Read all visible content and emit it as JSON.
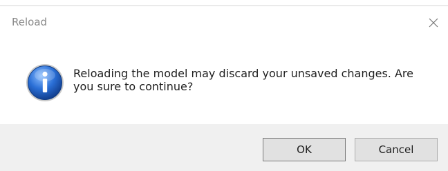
{
  "dialog": {
    "title": "Reload",
    "message": "Reloading the model may discard your unsaved changes. Are you sure to continue?",
    "icon": "info-icon",
    "buttons": {
      "ok_label": "OK",
      "cancel_label": "Cancel"
    }
  },
  "colors": {
    "title_text": "#8a8a8a",
    "footer_bg": "#f0f0f0",
    "button_bg": "#e1e1e1",
    "icon_blue": "#1f5fbf"
  }
}
